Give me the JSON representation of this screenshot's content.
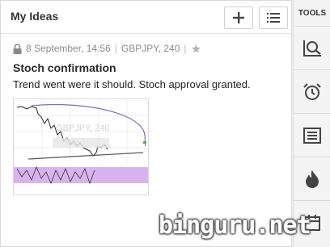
{
  "panel": {
    "title": "My Ideas",
    "add_icon": "plus-icon",
    "list_icon": "list-icon"
  },
  "idea": {
    "lock_icon": "lock-icon",
    "date": "8 September, 14:56",
    "symbol_interval": "GBPJPY, 240",
    "star_icon": "star-icon",
    "title": "Stoch confirmation",
    "description": "Trend went were it should. Stoch approval granted.",
    "thumbnail_label": "GBPJPY, 240"
  },
  "sidebar": {
    "label": "TOOLS",
    "items": [
      {
        "icon": "screener-search-icon"
      },
      {
        "icon": "alarm-clock-icon"
      },
      {
        "icon": "news-icon"
      },
      {
        "icon": "hotlist-flame-icon"
      },
      {
        "icon": "calendar-icon"
      }
    ]
  },
  "watermark": "binguru.net",
  "colors": {
    "accent": "#333333",
    "meta_text": "#8a8a8a",
    "stoch_band": "#d9b3f0"
  }
}
